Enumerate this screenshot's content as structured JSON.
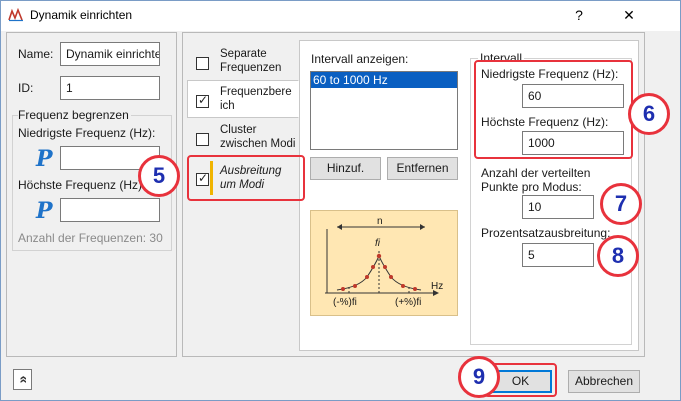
{
  "window": {
    "title": "Dynamik einrichten",
    "help_glyph": "?",
    "close_glyph": "✕"
  },
  "left": {
    "name_label": "Name:",
    "name_value": "Dynamik einrichten",
    "id_label": "ID:",
    "id_value": "1",
    "group_title": "Frequenz begrenzen",
    "min_label": "Niedrigste Frequenz (Hz):",
    "max_label": "Höchste Frequenz (Hz):",
    "min_value": "",
    "max_value": "",
    "p_glyph": "P",
    "count_text": "Anzahl der Frequenzen: 30"
  },
  "tabs": [
    {
      "label": "Separate Frequenzen",
      "checked": false
    },
    {
      "label": "Frequenzbereich",
      "checked": true
    },
    {
      "label": "Cluster zwischen Modi",
      "checked": false
    },
    {
      "label": "Ausbreitung um Modi",
      "checked": true
    }
  ],
  "interval_list": {
    "label": "Intervall anzeigen:",
    "items": [
      "60 to 1000 Hz"
    ],
    "add_button": "Hinzuf.",
    "remove_button": "Entfernen"
  },
  "diagram": {
    "n_label": "n",
    "fi_label": "fi",
    "hz_label": "Hz",
    "left_label": "(-%)fi",
    "right_label": "(+%)fi"
  },
  "interval": {
    "group_title": "Intervall",
    "min_label": "Niedrigste Frequenz (Hz):",
    "min_value": "60",
    "max_label": "Höchste Frequenz (Hz):",
    "max_value": "1000",
    "points_label": "Anzahl der verteilten Punkte pro Modus:",
    "points_value": "10",
    "spread_label": "Prozentsatzausbreitung:",
    "spread_value": "5"
  },
  "footer": {
    "expand_glyph": "»",
    "ok": "OK",
    "cancel": "Abbrechen"
  },
  "callouts": [
    "5",
    "6",
    "7",
    "8",
    "9"
  ],
  "colors": {
    "callout_border": "#e8323c",
    "callout_text": "#1e2fb0",
    "selection": "#0a5fc1",
    "active_tab_marker": "#f0b400",
    "p_icon": "#1f73c9"
  }
}
